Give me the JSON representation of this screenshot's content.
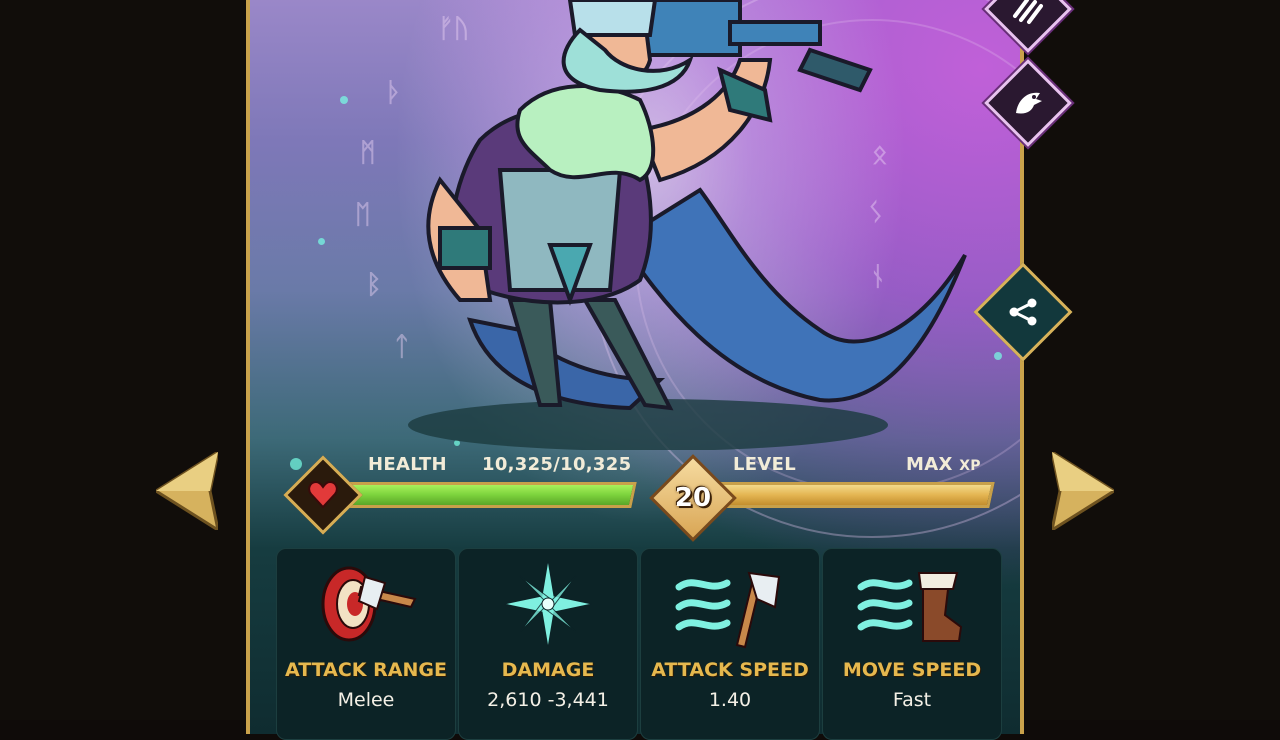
{
  "stats": {
    "health_label": "HEALTH",
    "health_value": "10,325/10,325",
    "health_fraction": 1.0,
    "level_label": "LEVEL",
    "level_number": "20",
    "xp_value": "MAX",
    "xp_unit": "XP",
    "xp_fraction": 1.0
  },
  "attributes": [
    {
      "title": "ATTACK RANGE",
      "value": "Melee",
      "icon": "target-axe-icon"
    },
    {
      "title": "DAMAGE",
      "value": "2,610 -3,441",
      "icon": "frost-star-icon"
    },
    {
      "title": "ATTACK SPEED",
      "value": "1.40",
      "icon": "wind-axe-icon"
    },
    {
      "title": "MOVE SPEED",
      "value": "Fast",
      "icon": "wind-boot-icon"
    }
  ],
  "colors": {
    "frame_gold": "#c9a24b",
    "health_green": "#7cd23c",
    "xp_gold": "#e4b552",
    "attr_title": "#e6b84e",
    "skill_border": "#e8c3ef"
  }
}
